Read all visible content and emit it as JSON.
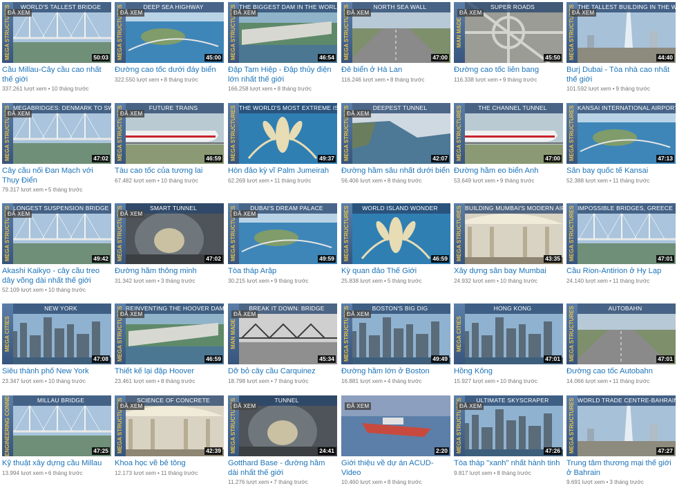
{
  "watched_label": "ĐÃ XEM",
  "views_suffix": "lượt xem",
  "videos": [
    {
      "band": "WORLD'S TALLEST BRIDGE",
      "brand": "MEGA STRUCTURES",
      "watched": true,
      "duration": "50:03",
      "title": "Cầu Millau-Cây cầu cao nhất thế giới",
      "views": "337.261",
      "age": "10 tháng trước",
      "scene": "bridge"
    },
    {
      "band": "DEEP SEA HIGHWAY",
      "brand": "MEGA STRUCTURES",
      "watched": true,
      "duration": "45:00",
      "title": "Đường cao tốc dưới đáy biển",
      "views": "322.550",
      "age": "8 tháng trước",
      "scene": "sea"
    },
    {
      "band": "THE BIGGEST DAM IN THE WORLD",
      "brand": "MEGA STRUCTURES",
      "watched": true,
      "duration": "46:54",
      "title": "Đập Tam Hiệp - Đập thủy điện lớn nhất thế giới",
      "views": "166.258",
      "age": "8 tháng trước",
      "scene": "dam"
    },
    {
      "band": "NORTH SEA WALL",
      "brand": "MEGA STRUCTURES",
      "watched": true,
      "duration": "47:00",
      "title": "Đê biển ở Hà Lan",
      "views": "116.246",
      "age": "8 tháng trước",
      "scene": "road"
    },
    {
      "band": "SUPER ROADS",
      "brand": "MAN MADE",
      "watched": true,
      "duration": "45:50",
      "title": "Đường cao tốc liên bang",
      "views": "116.338",
      "age": "9 tháng trước",
      "scene": "interchange"
    },
    {
      "band": "THE TALLEST BUILDING IN THE WORLD",
      "brand": "MEGA STRUCTURES",
      "watched": true,
      "duration": "44:40",
      "title": "Burj Dubai - Tòa nhà cao nhất thế giới",
      "views": "101.592",
      "age": "9 tháng trước",
      "scene": "tower"
    },
    {
      "band": "MEGABRIDGES: DENMARK TO SWEDEN",
      "brand": "MEGA STRUCTURES",
      "watched": true,
      "duration": "47:02",
      "title": "Cây cầu nối Đan Mạch với Thụy Điển",
      "views": "79.317",
      "age": "5 tháng trước",
      "scene": "bridge"
    },
    {
      "band": "FUTURE TRAINS",
      "brand": "MEGA STRUCTURES",
      "watched": true,
      "duration": "46:59",
      "title": "Tàu cao tốc của tương lai",
      "views": "67.482",
      "age": "10 tháng trước",
      "scene": "train"
    },
    {
      "band": "THE WORLD'S MOST EXTREME ISLAND",
      "brand": "MEGA STRUCTURES",
      "watched": false,
      "duration": "49:37",
      "title": "Hòn đảo kỳ vĩ Palm Jumeirah",
      "views": "62.269",
      "age": "11 tháng trước",
      "scene": "island"
    },
    {
      "band": "DEEPEST TUNNEL",
      "brand": "MEGA STRUCTURES",
      "watched": true,
      "duration": "42:07",
      "title": "Đường hầm sâu nhất dưới biển",
      "views": "56.406",
      "age": "8 tháng trước",
      "scene": "coast"
    },
    {
      "band": "THE CHANNEL TUNNEL",
      "brand": "MEGA STRUCTURES",
      "watched": false,
      "duration": "47:00",
      "title": "Đường hầm eo biển Anh",
      "views": "53.649",
      "age": "9 tháng trước",
      "scene": "train"
    },
    {
      "band": "KANSAI INTERNATIONAL AIRPORT",
      "brand": "MEGA STRUCTURES",
      "watched": false,
      "duration": "47:13",
      "title": "Sân bay quốc tế Kansai",
      "views": "52.388",
      "age": "11 tháng trước",
      "scene": "sea"
    },
    {
      "band": "LONGEST SUSPENSION BRIDGE",
      "brand": "MEGA STRUCTURES",
      "watched": true,
      "duration": "49:42",
      "title": "Akashi Kaikyo - cây cầu treo dây võng dài nhất thế giới",
      "views": "52.109",
      "age": "10 tháng trước",
      "scene": "bridge"
    },
    {
      "band": "SMART TUNNEL",
      "brand": "MEGA STRUCTURES",
      "watched": true,
      "duration": "47:02",
      "title": "Đường hầm thông minh",
      "views": "31.342",
      "age": "3 tháng trước",
      "scene": "tunnel"
    },
    {
      "band": "DUBAI'S DREAM PALACE",
      "brand": "MEGA STRUCTURES",
      "watched": true,
      "duration": "49:59",
      "title": "Tòa tháp Arập",
      "views": "30.215",
      "age": "9 tháng trước",
      "scene": "sea"
    },
    {
      "band": "WORLD ISLAND WONDER",
      "brand": "MEGA STRUCTURES",
      "watched": false,
      "duration": "46:59",
      "title": "Kỳ quan đảo Thế Giới",
      "views": "25.838",
      "age": "5 tháng trước",
      "scene": "island"
    },
    {
      "band": "BUILDING MUMBAI'S MODERN AIRPORT",
      "brand": "MEGA STRUCTURES",
      "watched": false,
      "duration": "43:35",
      "title": "Xây dựng sân bay Mumbai",
      "views": "24.932",
      "age": "10 tháng trước",
      "scene": "hall"
    },
    {
      "band": "IMPOSSIBLE BRIDGES, GREECE",
      "brand": "MEGA STRUCTURES",
      "watched": false,
      "duration": "47:01",
      "title": "Cầu Rion-Antirion ở Hy Lạp",
      "views": "24.140",
      "age": "11 tháng trước",
      "scene": "bridge"
    },
    {
      "band": "NEW YORK",
      "brand": "MEGA CITIES",
      "watched": false,
      "duration": "47:08",
      "title": "Siêu thành phố New York",
      "views": "23.347",
      "age": "10 tháng trước",
      "scene": "city"
    },
    {
      "band": "REINVENTING THE HOOVER DAM",
      "brand": "MEGA STRUCTURES",
      "watched": true,
      "duration": "46:59",
      "title": "Thiết kế lại đập Hoover",
      "views": "23.461",
      "age": "8 tháng trước",
      "scene": "dam"
    },
    {
      "band": "BREAK IT DOWN: BRIDGE",
      "brand": "MAN MADE",
      "watched": true,
      "duration": "45:34",
      "title": "Dỡ bỏ cây cầu Carquinez",
      "views": "18.798",
      "age": "7 tháng trước",
      "scene": "bw"
    },
    {
      "band": "BOSTON'S BIG DIG",
      "brand": "MEGA STRUCTURES",
      "watched": true,
      "duration": "49:49",
      "title": "Đường hầm lớn ở Boston",
      "views": "16.881",
      "age": "4 tháng trước",
      "scene": "city"
    },
    {
      "band": "HONG KONG",
      "brand": "MEGA CITIES",
      "watched": false,
      "duration": "47:01",
      "title": "Hồng Kông",
      "views": "15.927",
      "age": "10 tháng trước",
      "scene": "city"
    },
    {
      "band": "AUTOBAHN",
      "brand": "MEGA STRUCTURES",
      "watched": false,
      "duration": "47:01",
      "title": "Đường cao tốc Autobahn",
      "views": "14.066",
      "age": "11 tháng trước",
      "scene": "road"
    },
    {
      "band": "MILLAU BRIDGE",
      "brand": "ENGINEERING CONNECTIONS",
      "watched": false,
      "duration": "47:25",
      "title": "Kỹ thuật xây dựng cầu Millau",
      "views": "13.994",
      "age": "6 tháng trước",
      "scene": "bridge"
    },
    {
      "band": "SCIENCE OF CONCRETE",
      "brand": "MEGA STRUCTURES",
      "watched": true,
      "duration": "42:39",
      "title": "Khoa học về bê tông",
      "views": "12.173",
      "age": "11 tháng trước",
      "scene": "hall"
    },
    {
      "band": "TUNNEL",
      "brand": "MEGA STRUCTURES",
      "watched": true,
      "duration": "24:41",
      "title": "Gotthard Base - đường hầm dài nhất thế giới",
      "views": "11.276",
      "age": "7 tháng trước",
      "scene": "tunnel"
    },
    {
      "band": "",
      "brand": "",
      "watched": true,
      "duration": "2:20",
      "title": "Giới thiệu về dự án ACUD-Video",
      "views": "10.460",
      "age": "8 tháng trước",
      "scene": "ship"
    },
    {
      "band": "ULTIMATE SKYSCRAPER",
      "brand": "MEGA STRUCTURES",
      "watched": true,
      "duration": "47:26",
      "title": "Tòa tháp \"xanh\" nhất hành tinh",
      "views": "9.817",
      "age": "8 tháng trước",
      "scene": "city"
    },
    {
      "band": "WORLD TRADE CENTRE-BAHRAIN",
      "brand": "MEGA STRUCTURES",
      "watched": false,
      "duration": "47:27",
      "title": "Trung tâm thương mại thế giới ở Bahrain",
      "views": "9.691",
      "age": "3 tháng trước",
      "scene": "tower"
    }
  ]
}
